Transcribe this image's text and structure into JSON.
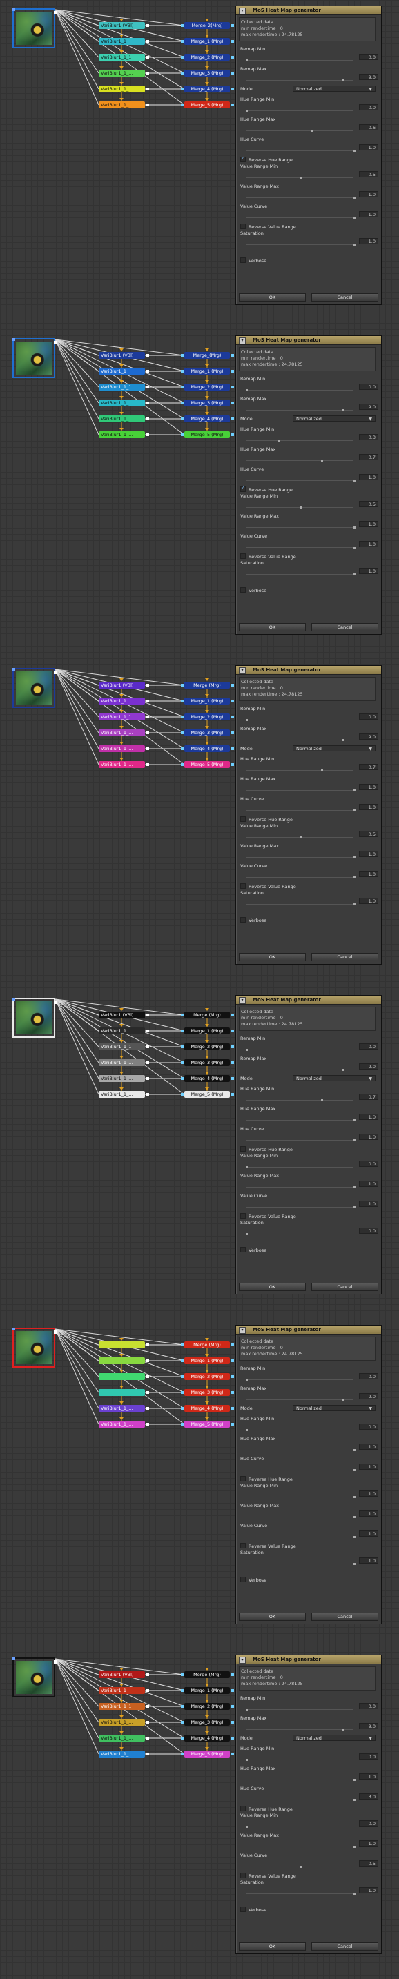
{
  "dialog": {
    "title": "MoS Heat Map generator",
    "info_title": "Collected data",
    "min_render": "min rendertime : 0",
    "max_render": "max rendertime : 24.78125",
    "labels": {
      "remap_min": "Remap Min",
      "remap_max": "Remap Max",
      "mode": "Mode",
      "hue_min": "Hue Range Min",
      "hue_max": "Hue Range Max",
      "hue_curve": "Hue Curve",
      "rev_hue": "Reverse Hue Range",
      "val_min": "Value Range Min",
      "val_max": "Value Range Max",
      "val_curve": "Value Curve",
      "rev_val": "Reverse Value Range",
      "saturation": "Saturation",
      "verbose": "Verbose",
      "ok": "OK",
      "cancel": "Cancel"
    }
  },
  "colors": {
    "accent": "#1e6fd0",
    "title_bar": "#b8a46a"
  },
  "panels": [
    {
      "src_border": "#1e6fd0",
      "src_label": "",
      "blur_labels": [
        "VariBlur1 (VBl)",
        "VariBlur1_1",
        "VariBlur1_1_1",
        "VariBlur1_1_...",
        "VariBlur1_1_...",
        "VariBlur1_1_..."
      ],
      "blur_colors": [
        "#3fc0c0",
        "#30b8c8",
        "#3cd0b0",
        "#54d050",
        "#d8e020",
        "#f0901c"
      ],
      "merge_labels": [
        "Merge_2(Mrg)",
        "Merge_1 (Mrg)",
        "Merge_2 (Mrg)",
        "Merge_3 (Mrg)",
        "Merge_4 (Mrg)",
        "Merge_5 (Mrg)"
      ],
      "merge_colors": [
        "#1c3a9a",
        "#1c3a9a",
        "#1c3a9a",
        "#1c3a9a",
        "#1c3a9a",
        "#d02818"
      ],
      "remap_min": "0.0",
      "remap_max": "9.0",
      "mode": "Normalized",
      "hue_min": "0.0",
      "hue_max": "0.6",
      "hue_curve": "1.0",
      "rev_hue": true,
      "val_min": "0.5",
      "val_max": "1.0",
      "val_curve": "1.0",
      "rev_val": false,
      "saturation": "1.0"
    },
    {
      "src_border": "#1e6fd0",
      "src_label": "",
      "blur_labels": [
        "VariBlur1 (VBl)",
        "VariBlur1_1",
        "VariBlur1_1_1",
        "VariBlur1_1_...",
        "VariBlur1_1_...",
        "VariBlur1_1_..."
      ],
      "blur_colors": [
        "#1c3a9a",
        "#1d6ad0",
        "#1e8ed0",
        "#28b8c8",
        "#30c878",
        "#48d038"
      ],
      "merge_labels": [
        "Merge_(Mrg)",
        "Merge_1 (Mrg)",
        "Merge_2 (Mrg)",
        "Merge_3 (Mrg)",
        "Merge_4 (Mrg)",
        "Merge_5 (Mrg)"
      ],
      "merge_colors": [
        "#1c3a9a",
        "#1c3a9a",
        "#1c3a9a",
        "#1c3a9a",
        "#1c3a9a",
        "#48d038"
      ],
      "remap_min": "0.0",
      "remap_max": "9.0",
      "mode": "Normalized",
      "hue_min": "0.3",
      "hue_max": "0.7",
      "hue_curve": "1.0",
      "rev_hue": true,
      "val_min": "0.5",
      "val_max": "1.0",
      "val_curve": "1.0",
      "rev_val": false,
      "saturation": "1.0"
    },
    {
      "src_border": "#1c3a9a",
      "src_label": "",
      "blur_labels": [
        "VariBlur1 (VBl)",
        "VariBlur1_1",
        "VariBlur1_1_1",
        "VariBlur1_1_...",
        "VariBlur1_1_...",
        "VariBlur1_1_..."
      ],
      "blur_colors": [
        "#5a2ac8",
        "#7a30d0",
        "#9038d0",
        "#a840c0",
        "#c030a8",
        "#e02888"
      ],
      "merge_labels": [
        "Merge (Mrg)",
        "Merge_1 (Mrg)",
        "Merge_2 (Mrg)",
        "Merge_3 (Mrg)",
        "Merge_4 (Mrg)",
        "Merge_5 (Mrg)"
      ],
      "merge_colors": [
        "#1c3a9a",
        "#1c3a9a",
        "#1c3a9a",
        "#1c3a9a",
        "#1c3a9a",
        "#e02888"
      ],
      "remap_min": "0.0",
      "remap_max": "9.0",
      "mode": "Normalized",
      "hue_min": "0.7",
      "hue_max": "1.0",
      "hue_curve": "1.0",
      "rev_hue": false,
      "val_min": "0.5",
      "val_max": "1.0",
      "val_curve": "1.0",
      "rev_val": false,
      "saturation": "1.0"
    },
    {
      "src_border": "#eaeaea",
      "src_label": "",
      "blur_labels": [
        "VariBlur1 (VBl)",
        "VariBlur1_1",
        "VariBlur1_1_1",
        "VariBlur1_1_...",
        "VariBlur1_1_...",
        "VariBlur1_1_..."
      ],
      "blur_colors": [
        "#111111",
        "#2a2a2a",
        "#555555",
        "#808080",
        "#a8a8a8",
        "#e8e8e8"
      ],
      "merge_labels": [
        "Merge (Mrg)",
        "Merge_1 (Mrg)",
        "Merge_2 (Mrg)",
        "Merge_3 (Mrg)",
        "Merge_4 (Mrg)",
        "Merge_5 (Mrg)"
      ],
      "merge_colors": [
        "#111111",
        "#111111",
        "#111111",
        "#111111",
        "#111111",
        "#e8e8e8"
      ],
      "remap_min": "0.0",
      "remap_max": "9.0",
      "mode": "Normalized",
      "hue_min": "0.7",
      "hue_max": "1.0",
      "hue_curve": "1.0",
      "rev_hue": false,
      "val_min": "0.0",
      "val_max": "1.0",
      "val_curve": "1.0",
      "rev_val": false,
      "saturation": "0.0"
    },
    {
      "src_border": "#e02020",
      "src_label": "",
      "blur_labels": [
        "",
        "",
        "",
        "",
        "VariBlur1_1_...",
        "VariBlur1_1_..."
      ],
      "blur_colors": [
        "#c8e030",
        "#88d840",
        "#40d870",
        "#30c8b0",
        "#6a40d0",
        "#d040c8"
      ],
      "merge_labels": [
        "Merge (Mrg)",
        "Merge_1 (Mrg)",
        "Merge_2 (Mrg)",
        "Merge_3 (Mrg)",
        "Merge_4 (Mrg)",
        "Merge_5 (Mrg)"
      ],
      "merge_colors": [
        "#d02818",
        "#d02818",
        "#d02818",
        "#d02818",
        "#d02818",
        "#d040c8"
      ],
      "remap_min": "0.0",
      "remap_max": "9.0",
      "mode": "Normalized",
      "hue_min": "0.0",
      "hue_max": "1.0",
      "hue_curve": "1.0",
      "rev_hue": false,
      "val_min": "1.0",
      "val_max": "1.0",
      "val_curve": "1.0",
      "rev_val": false,
      "saturation": "1.0"
    },
    {
      "src_border": "#111111",
      "src_label": "",
      "blur_labels": [
        "VariBlur1 (VBl)",
        "VariBlur1_1",
        "VariBlur1_1_1",
        "VariBlur1_1_...",
        "VariBlur1_1_...",
        "VariBlur1_1_..."
      ],
      "blur_colors": [
        "#b01818",
        "#c03018",
        "#c86020",
        "#c8a028",
        "#40c060",
        "#2080d0"
      ],
      "merge_labels": [
        "Merge (Mrg)",
        "Merge_1 (Mrg)",
        "Merge_2 (Mrg)",
        "Merge_3 (Mrg)",
        "Merge_4 (Mrg)",
        "Merge_5 (Mrg)"
      ],
      "merge_colors": [
        "#111111",
        "#111111",
        "#111111",
        "#111111",
        "#111111",
        "#d040c8"
      ],
      "remap_min": "0.0",
      "remap_max": "9.0",
      "mode": "Normalized",
      "hue_min": "0.0",
      "hue_max": "1.0",
      "hue_curve": "3.0",
      "rev_hue": false,
      "val_min": "0.0",
      "val_max": "1.0",
      "val_curve": "0.5",
      "rev_val": false,
      "saturation": "1.0"
    }
  ]
}
